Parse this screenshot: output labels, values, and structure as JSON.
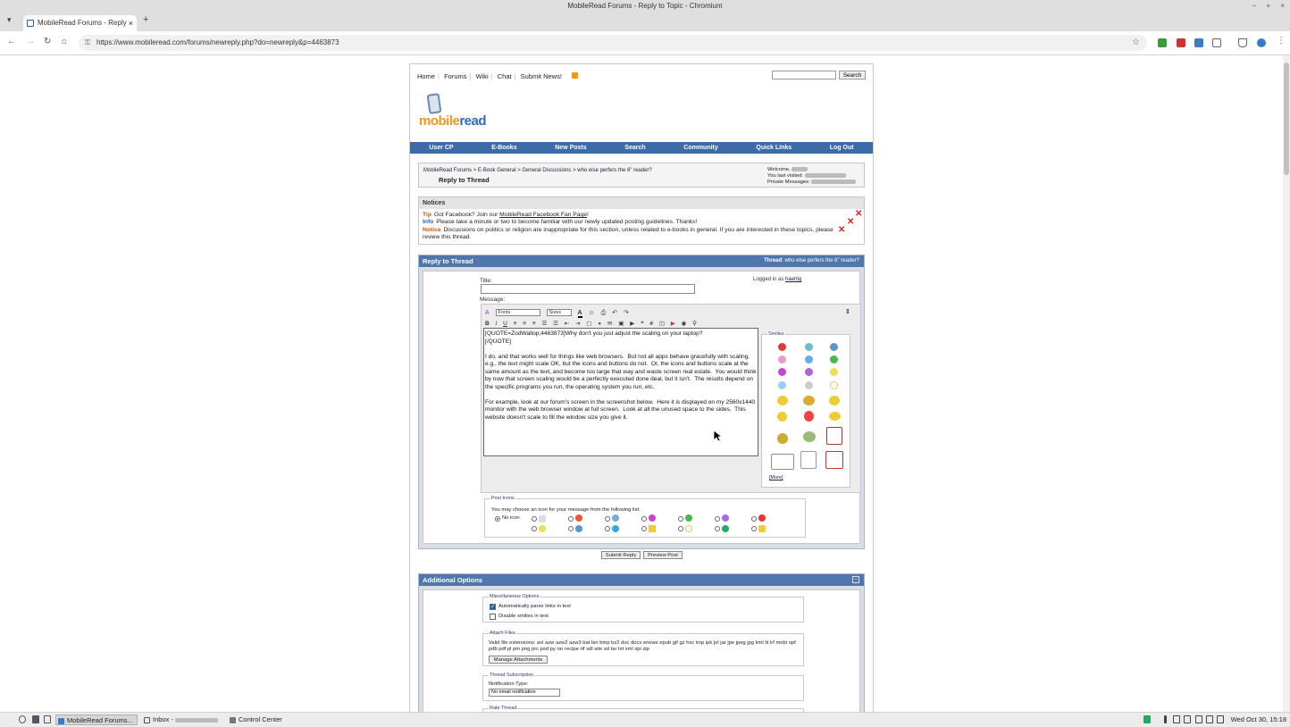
{
  "window": {
    "title": "MobileRead Forums - Reply to Topic - Chromium",
    "controls": [
      "−",
      "+",
      "×"
    ]
  },
  "tab": {
    "label": "MobileRead Forums - Reply",
    "close": "×",
    "new": "+"
  },
  "address": {
    "url": "https://www.mobileread.com/forums/newreply.php?do=newreply&p=4463873"
  },
  "site": {
    "toplinks": [
      "Home",
      "Forums",
      "Wiki",
      "Chat",
      "Submit News!"
    ],
    "search_button": "Search",
    "logo_a": "mobile",
    "logo_b": "read",
    "navbar": [
      "User CP",
      "E-Books",
      "New Posts",
      "Search",
      "Community",
      "Quick Links",
      "Log Out"
    ]
  },
  "breadcrumb": {
    "path": "MobileRead Forums > E-Book General > General Discussions > who else perfers the 6\" reader?",
    "title": "Reply to Thread",
    "welcome": "Welcome,",
    "last_visited": "You last visited:",
    "private_messages": "Private Messages:"
  },
  "notices": {
    "header": "Notices",
    "items": [
      {
        "label": "Tip",
        "text_a": "Got Facebook? Join our ",
        "link": "MobileRead Facebook Fan Page",
        "text_b": "!"
      },
      {
        "label": "Info",
        "text_a": "Please take a minute or two to become familiar with our newly updated ",
        "link": "posting guidelines",
        "text_b": ". Thanks!"
      },
      {
        "label": "Notice",
        "text_a": "Discussions on politics or religion are inappropriate for this section, unless related to e-books in general. If you are interested in these topics, please ",
        "link": "review this thread",
        "text_b": "."
      }
    ]
  },
  "reply": {
    "header": "Reply to Thread",
    "thread_label": "Thread",
    "thread_name": ": who else perfers the 6\" reader?",
    "title_label": "Title:",
    "message_label": "Message:",
    "logged_in_as": "Logged in as ",
    "username": "haertig",
    "font_select": "Fonts",
    "size_select": "Sizes",
    "message_text": "[QUOTE=ZodWallop;4463873]Why don't you just adjust the scaling on your laptop?\n[/QUOTE]\n\nI do, and that works well for things like web browsers.  But not all apps behave gracefully with scaling.  e.g., the text might scale OK, but the icons and buttons do not.  Or, the icons and buttons scale at the same amount as the text, and become too large that way and waste screen real estate.  You would think by now that screen scaling would be a perfectly executed done deal, but it isn't.  The results depend on the specific programs you run, the operating system you run, etc.\n\nFor example, look at our forum's screen in the screenshot below.  Here it is displayed on my 2560x1440 monitor with the web browser window at full screen.  Look at all the unused space to the sides.  This website doesn't scale to fill the window size you give it.",
    "smilies_legend": "Smilies",
    "smilies_more": "[More]",
    "post_icons_legend": "Post Icons",
    "post_icons_text": "You may choose an icon for your message from the following list:",
    "no_icon": "No icon",
    "submit": "Submit Reply",
    "preview": "Preview Post"
  },
  "additional": {
    "header": "Additional Options",
    "misc_legend": "Miscellaneous Options",
    "parse_links": "Automatically parse links in text",
    "disable_smilies": "Disable smilies in text",
    "attach_legend": "Attach Files",
    "valid_ext": "Valid file extensions: avi azw azw2 azw3 bat bin bmp bz2 doc docx enews epub gif gz hsc imp ipk jol jar jpe jpeg jpg kml lit lrf mobi opf pdb pdf pl pm png prc psd py rar recipe rtf sdl site sd tar txt xml xpi zip",
    "manage_attachments": "Manage Attachments",
    "subscription_legend": "Thread Subscription",
    "notification_type": "Notification Type:",
    "notification_value": "No email notification",
    "rate_legend": "Rate Thread"
  },
  "taskbar": {
    "tasks": [
      "MobileRead Forums...",
      "Inbox -",
      "Control Center"
    ],
    "clock": "Wed Oct 30, 15:18"
  },
  "colors": {
    "navbar": "#3e6aa8",
    "section_header": "#4f77ad",
    "logo_orange": "#f29722",
    "logo_blue": "#2a6bbb"
  }
}
